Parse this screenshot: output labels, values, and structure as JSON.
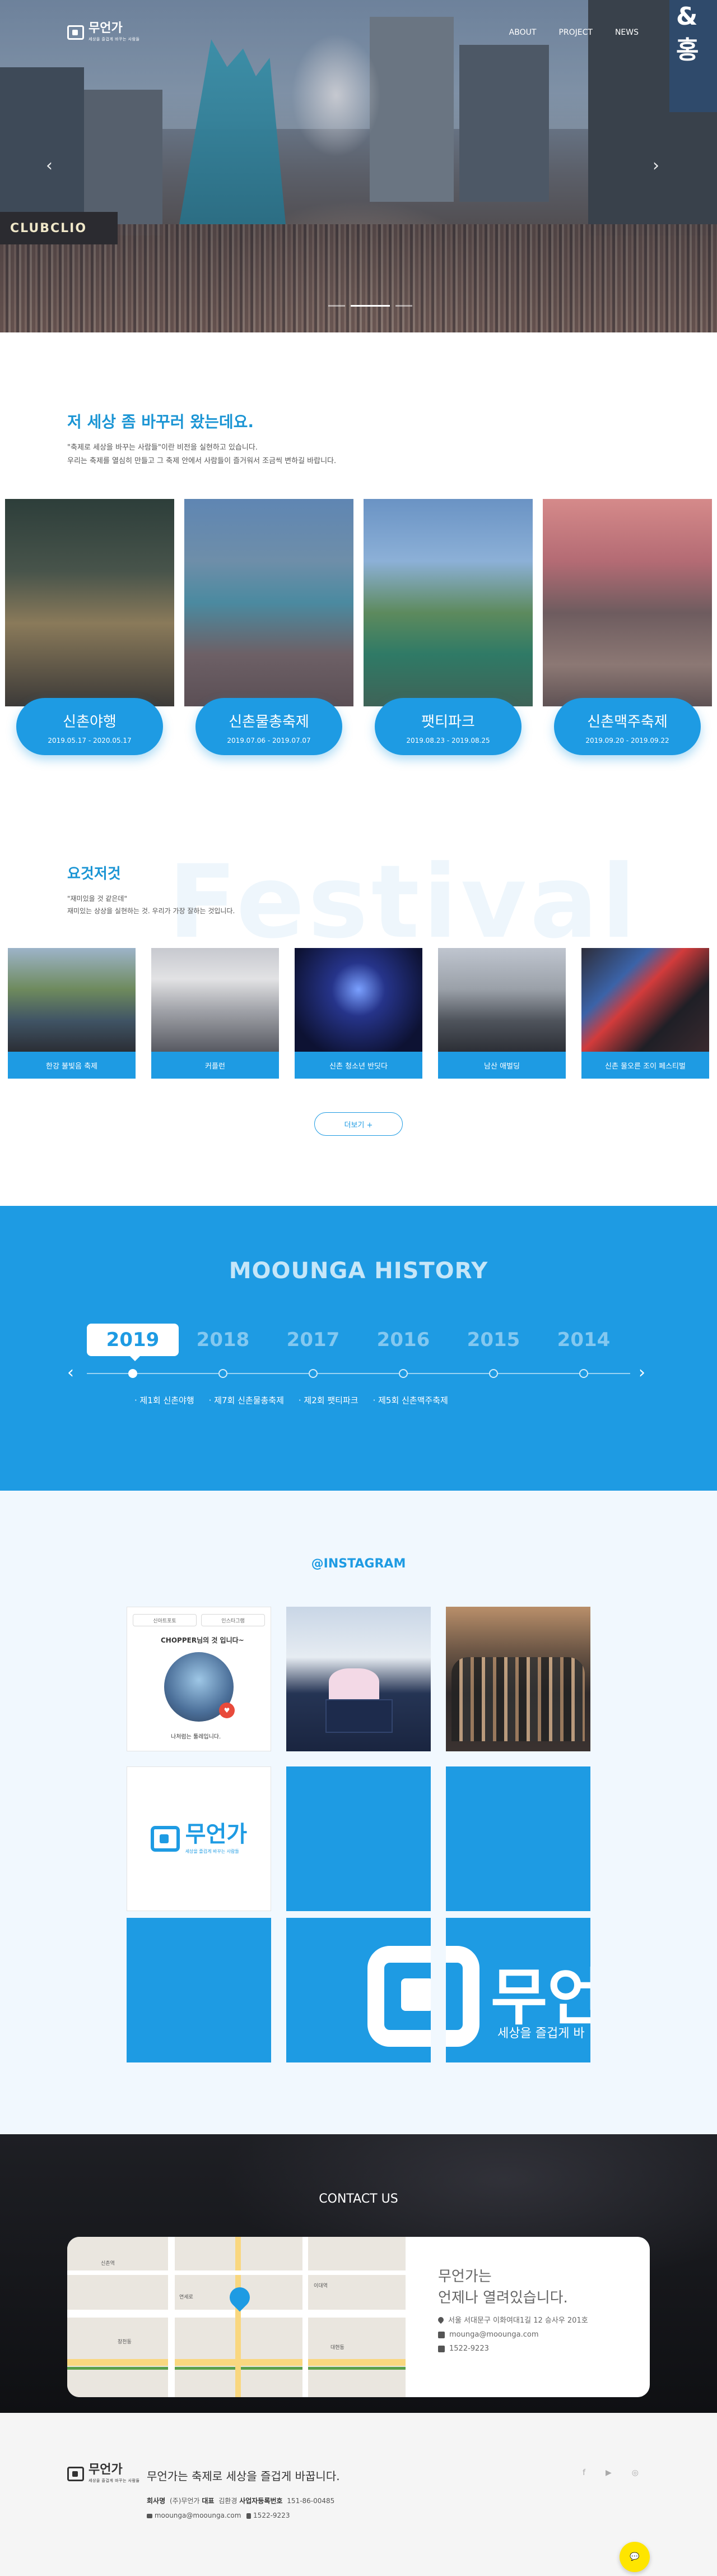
{
  "brand": {
    "name": "무언가",
    "sub": "세상을 즐겁게 바꾸는 사람들"
  },
  "nav": {
    "items": [
      "ABOUT",
      "PROJECT",
      "NEWS"
    ]
  },
  "hero": {
    "sign": "CLUBCLIO",
    "sign2": "&\n홍",
    "prev": "‹",
    "next": "›",
    "slides": 3,
    "active_slide": 0
  },
  "intro": {
    "title": "저 세상 좀 바꾸러 왔는데요.",
    "lines": [
      "\"축제로 세상을 바꾸는 사람들\"이란 비전을 실현하고 있습니다.",
      "우리는 축제를 열심히 만들고 그 축제 안에서 사람들이 즐거워서 조금씩 변하길 바랍니다."
    ]
  },
  "cards": [
    {
      "title": "신촌야행",
      "date": "2019.05.17 - 2020.05.17"
    },
    {
      "title": "신촌물총축제",
      "date": "2019.07.06 - 2019.07.07"
    },
    {
      "title": "팻티파크",
      "date": "2019.08.23 - 2019.08.25"
    },
    {
      "title": "신촌맥주축제",
      "date": "2019.09.20 - 2019.09.22"
    }
  ],
  "festival": {
    "watermark": "Festival",
    "title": "요것저것",
    "lines": [
      "\"재미있을 것 같은데\"",
      "재미있는 상상을 실현하는 것. 우리가 가장 잘하는 것입니다."
    ],
    "items": [
      "한강 불빛음 축제",
      "커플런",
      "신촌 청소년 반딧다",
      "남산 애벌딩",
      "신촌 물오른 조이 페스티벌"
    ],
    "more": "더보기 +"
  },
  "history": {
    "title": "MOOUNGA HISTORY",
    "years": [
      "2019",
      "2018",
      "2017",
      "2016",
      "2015",
      "2014"
    ],
    "active": 0,
    "events": [
      "· 제1회 신촌야행",
      "· 제7회 신촌물총축제",
      "· 제2회 팻티파크",
      "· 제5회 신촌맥주축제"
    ],
    "prev": "‹",
    "next": "›"
  },
  "instagram": {
    "title": "@INSTAGRAM",
    "shot": {
      "tab1": "신아트포토",
      "tab2": "인스타그램",
      "heading": "CHOPPER님의 것 입니다~",
      "badge": "♥",
      "caption": "나처럼는 툴레입니다."
    },
    "logo_name": "무언가",
    "logo_sub": "세상을 즐겁게 바꾸는 사람들",
    "big_name": "무언",
    "big_sub": "세상을 즐겁게 바"
  },
  "contact": {
    "title": "CONTACT US",
    "tagline": [
      "무언가는",
      "언제나 열려있습니다."
    ],
    "address": "서울 서대문구 이화여대1길 12 승사우 201호",
    "email": "mounga@moounga.com",
    "phone": "1522-9223",
    "map_labels": [
      "신촌역",
      "연세로",
      "이대역",
      "창천동",
      "대현동"
    ]
  },
  "footer": {
    "slogan": "무언가는 축제로 세상을 즐겁게 바꿉니다.",
    "company_label": "회사명",
    "company": "(주)무언가",
    "ceo_label": "대표",
    "ceo": "김환경",
    "biz_label": "사업자등록번호",
    "biz": "151-86-00485",
    "email": "moounga@moounga.com",
    "phone": "1522-9223",
    "socials": [
      "f",
      "▶",
      "◎"
    ],
    "chat": "💬"
  },
  "colors": {
    "accent": "#1e9be3",
    "dark": "#111215",
    "footer_bg": "#f5f5f5"
  }
}
